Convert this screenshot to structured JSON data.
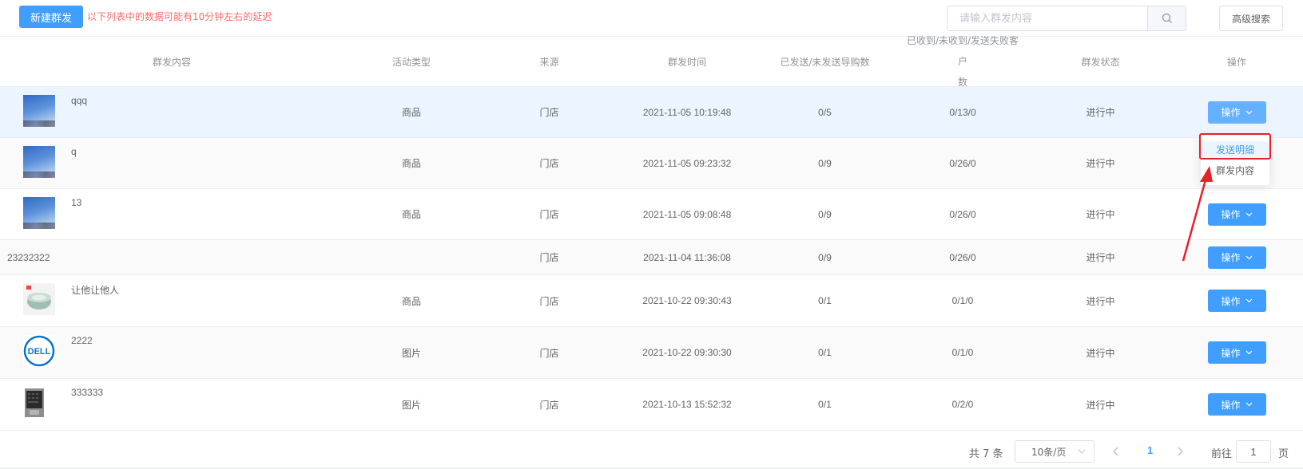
{
  "toolbar": {
    "new_button": "新建群发",
    "notice": "以下列表中的数据可能有10分钟左右的延迟",
    "search_placeholder": "请输入群发内容",
    "advanced_search": "高级搜索"
  },
  "table": {
    "headers": {
      "content": "群发内容",
      "activity_type": "活动类型",
      "source": "来源",
      "send_time": "群发时间",
      "sent_unsent": "已发送/未发送导购数",
      "received_line1": "已收到/未收到/发送失败客户",
      "received_line2": "数",
      "status": "群发状态",
      "operation": "操作"
    },
    "rows": [
      {
        "content": "qqq",
        "thumb": "sky-icon",
        "type": "商品",
        "source": "门店",
        "time": "2021-11-05 10:19:48",
        "sent": "0/5",
        "received": "0/13/0",
        "status": "进行中",
        "op": "操作"
      },
      {
        "content": "q",
        "thumb": "sky-icon",
        "type": "商品",
        "source": "门店",
        "time": "2021-11-05 09:23:32",
        "sent": "0/9",
        "received": "0/26/0",
        "status": "进行中",
        "op": "操作"
      },
      {
        "content": "13",
        "thumb": "sky-icon",
        "type": "商品",
        "source": "门店",
        "time": "2021-11-05 09:08:48",
        "sent": "0/9",
        "received": "0/26/0",
        "status": "进行中",
        "op": "操作"
      },
      {
        "content": "23232322",
        "thumb": "",
        "type": "",
        "source": "门店",
        "time": "2021-11-04 11:36:08",
        "sent": "0/9",
        "received": "0/26/0",
        "status": "进行中",
        "op": "操作"
      },
      {
        "content": "让他让他人",
        "thumb": "bowl-icon",
        "type": "商品",
        "source": "门店",
        "time": "2021-10-22 09:30:43",
        "sent": "0/1",
        "received": "0/1/0",
        "status": "进行中",
        "op": "操作"
      },
      {
        "content": "2222",
        "thumb": "dell-logo-icon",
        "type": "图片",
        "source": "门店",
        "time": "2021-10-22 09:30:30",
        "sent": "0/1",
        "received": "0/1/0",
        "status": "进行中",
        "op": "操作"
      },
      {
        "content": "333333",
        "thumb": "laptop-icon",
        "type": "图片",
        "source": "门店",
        "time": "2021-10-13 15:52:32",
        "sent": "0/1",
        "received": "0/2/0",
        "status": "进行中",
        "op": "操作"
      }
    ]
  },
  "dropdown": {
    "item1": "发送明细",
    "item2": "群发内容"
  },
  "pagination": {
    "total": "共 7 条",
    "page_size": "10条/页",
    "current_page": "1",
    "goto_label": "前往",
    "goto_value": "1",
    "goto_unit": "页"
  },
  "colors": {
    "primary": "#409eff",
    "warning_text": "#f56c6c",
    "annotation_red": "#e8202a"
  }
}
